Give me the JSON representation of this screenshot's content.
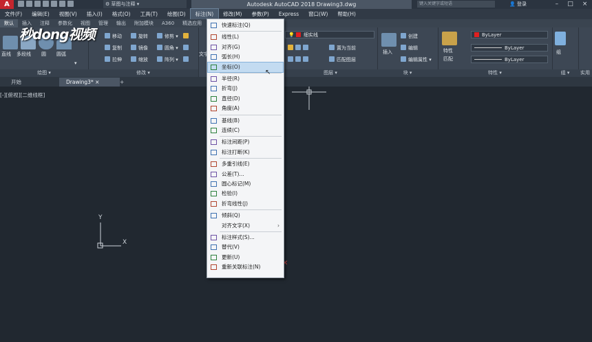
{
  "window": {
    "title": "Autodesk AutoCAD 2018    Drawing3.dwg",
    "workspace": "草图与注释",
    "search_placeholder": "键入关键字或短语",
    "login": "登录"
  },
  "menubar": [
    "文件(F)",
    "编辑(E)",
    "视图(V)",
    "插入(I)",
    "格式(O)",
    "工具(T)",
    "绘图(D)",
    "标注(N)",
    "修改(M)",
    "参数(P)",
    "Express",
    "窗口(W)",
    "帮助(H)"
  ],
  "ribbon_tabs": [
    "默认",
    "插入",
    "注释",
    "参数化",
    "视图",
    "管理",
    "输出",
    "附加模块",
    "A360",
    "精选应用"
  ],
  "ribbon": {
    "panels": {
      "draw": "绘图",
      "modify": "修改",
      "layer": "图层",
      "block": "块",
      "properties": "特性",
      "group": "组",
      "utilities": "实用"
    },
    "draw_tools": [
      "直线",
      "多段线",
      "圆",
      "圆弧"
    ],
    "modify_tools": [
      "移动",
      "旋转",
      "修剪",
      "复制",
      "镜像",
      "圆角",
      "拉伸",
      "缩放",
      "阵列"
    ],
    "layer_tools": [
      "置为当前",
      "匹配图层"
    ],
    "layer_combo": "细实线",
    "block_tools": [
      "插入",
      "创建",
      "编辑",
      "编辑属性"
    ],
    "props_tools": [
      "特性",
      "匹配"
    ],
    "bylayer_1": "ByLayer",
    "bylayer_2": "ByLayer",
    "bylayer_3": "ByLayer",
    "group_label": "组",
    "text_tool": "文字"
  },
  "watermark": "秒dong视频",
  "doc_tabs": [
    "开始",
    "Drawing3*",
    "+"
  ],
  "viewport_label": "[-][俯视][二维线框]",
  "ucs": {
    "x_label": "X",
    "y_label": "Y"
  },
  "dim_menu": [
    {
      "label": "快速标注(Q)",
      "icon": "quick-dimension-icon"
    },
    {
      "sep": true
    },
    {
      "label": "线性(L)",
      "icon": "linear-dimension-icon"
    },
    {
      "label": "对齐(G)",
      "icon": "aligned-dimension-icon"
    },
    {
      "label": "弧长(H)",
      "icon": "arc-length-icon"
    },
    {
      "label": "坐标(O)",
      "icon": "ordinate-dimension-icon",
      "highlight": true
    },
    {
      "sep": true
    },
    {
      "label": "半径(R)",
      "icon": "radius-dimension-icon"
    },
    {
      "label": "折弯(J)",
      "icon": "jogged-dimension-icon"
    },
    {
      "label": "直径(D)",
      "icon": "diameter-dimension-icon"
    },
    {
      "label": "角度(A)",
      "icon": "angular-dimension-icon"
    },
    {
      "sep": true
    },
    {
      "label": "基线(B)",
      "icon": "baseline-dimension-icon"
    },
    {
      "label": "连续(C)",
      "icon": "continue-dimension-icon"
    },
    {
      "sep": true
    },
    {
      "label": "标注间距(P)",
      "icon": "dimension-space-icon"
    },
    {
      "label": "标注打断(K)",
      "icon": "dimension-break-icon"
    },
    {
      "sep": true
    },
    {
      "label": "多重引线(E)",
      "icon": "multileader-icon"
    },
    {
      "label": "公差(T)...",
      "icon": "tolerance-icon"
    },
    {
      "label": "圆心标记(M)",
      "icon": "center-mark-icon"
    },
    {
      "label": "检验(I)",
      "icon": "inspection-icon"
    },
    {
      "label": "折弯线性(J)",
      "icon": "jogged-linear-icon"
    },
    {
      "sep": true
    },
    {
      "label": "倾斜(Q)",
      "icon": "oblique-icon"
    },
    {
      "label": "对齐文字(X)",
      "icon": "",
      "submenu": true
    },
    {
      "sep": true
    },
    {
      "label": "标注样式(S)...",
      "icon": "dimension-style-icon"
    },
    {
      "label": "替代(V)",
      "icon": "override-icon"
    },
    {
      "label": "更新(U)",
      "icon": "update-icon"
    },
    {
      "label": "重新关联标注(N)",
      "icon": "reassociate-icon"
    }
  ],
  "colors": {
    "accent": "#c4262e",
    "canvas": "#212830",
    "highlight": "#c3dbf1"
  }
}
